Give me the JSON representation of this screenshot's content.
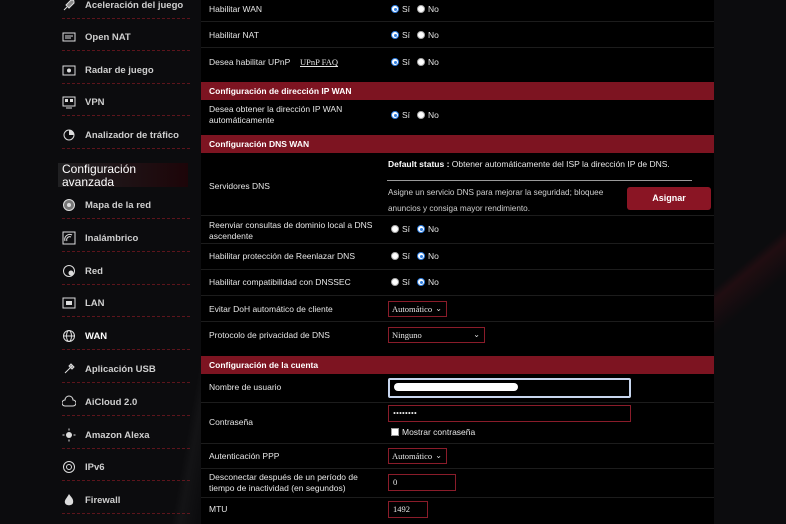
{
  "sidebar": {
    "items_top": [
      {
        "label": "Aceleración del juego",
        "icon": "rocket-icon"
      },
      {
        "label": "Open NAT",
        "icon": "router-icon"
      },
      {
        "label": "Radar de juego",
        "icon": "radar-icon"
      },
      {
        "label": "VPN",
        "icon": "vpn-icon"
      },
      {
        "label": "Analizador de tráfico",
        "icon": "traffic-analyzer-icon"
      }
    ],
    "section_title": "Configuración avanzada",
    "items_advanced": [
      {
        "label": "Mapa de la red",
        "icon": "network-map-icon"
      },
      {
        "label": "Inalámbrico",
        "icon": "wireless-icon"
      },
      {
        "label": "Red",
        "icon": "network-icon"
      },
      {
        "label": "LAN",
        "icon": "lan-icon"
      },
      {
        "label": "WAN",
        "icon": "globe-icon",
        "active": true
      },
      {
        "label": "Aplicación USB",
        "icon": "usb-icon"
      },
      {
        "label": "AiCloud 2.0",
        "icon": "cloud-icon"
      },
      {
        "label": "Amazon Alexa",
        "icon": "alexa-icon"
      },
      {
        "label": "IPv6",
        "icon": "ipv6-icon"
      },
      {
        "label": "Firewall",
        "icon": "firewall-icon"
      }
    ]
  },
  "radio": {
    "yes": "Sí",
    "no": "No"
  },
  "basic": {
    "enable_wan": {
      "label": "Habilitar WAN",
      "value": "yes"
    },
    "enable_nat": {
      "label": "Habilitar NAT",
      "value": "yes"
    },
    "enable_upnp": {
      "label": "Desea habilitar UPnP",
      "value": "yes",
      "link": "UPnP FAQ"
    }
  },
  "wan_ip": {
    "header": "Configuración de dirección IP WAN",
    "auto_ip": {
      "label": "Desea obtener la dirección IP WAN automáticamente",
      "value": "yes"
    }
  },
  "dns": {
    "header": "Configuración DNS WAN",
    "status_label": "Default status :",
    "status_value": "Obtener automáticamente del ISP la dirección IP de DNS.",
    "servers_label": "Servidores DNS",
    "description": "Asigne un servicio DNS para mejorar la seguridad; bloquee anuncios y consiga mayor rendimiento.",
    "assign_button": "Asignar",
    "forward_local": {
      "label": "Reenviar consultas de dominio local a DNS ascendente",
      "value": "no"
    },
    "rebind": {
      "label": "Habilitar protección de Reenlazar DNS",
      "value": "no"
    },
    "dnssec": {
      "label": "Habilitar compatibilidad con DNSSEC",
      "value": "no"
    },
    "doh": {
      "label": "Evitar DoH automático de cliente",
      "value": "Automático"
    },
    "privacy": {
      "label": "Protocolo de privacidad de DNS",
      "value": "Ninguno"
    }
  },
  "account": {
    "header": "Configuración de la cuenta",
    "username_label": "Nombre de usuario",
    "password_label": "Contraseña",
    "password_value": "••••••••",
    "show_password": "Mostrar contraseña",
    "ppp_auth": {
      "label": "Autenticación PPP",
      "value": "Automático"
    },
    "idle_disconnect": {
      "label": "Desconectar después de un período de tiempo de inactividad (en segundos)",
      "value": "0"
    },
    "mtu": {
      "label": "MTU",
      "value": "1492"
    }
  }
}
